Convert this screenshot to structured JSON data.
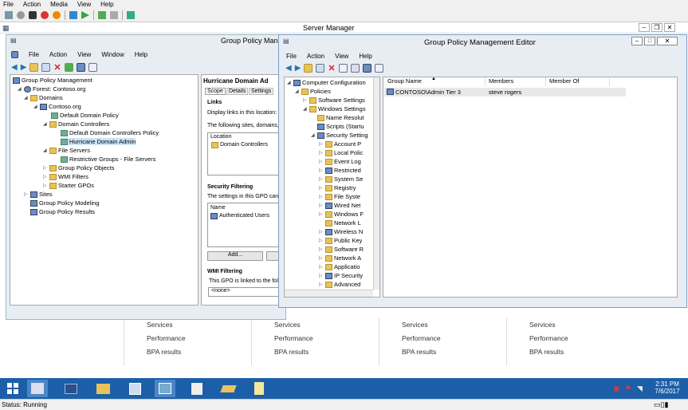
{
  "vm_menu": [
    "File",
    "Action",
    "Media",
    "View",
    "Help"
  ],
  "server_manager": {
    "title": "Server Manager",
    "tiles": [
      {
        "items": [
          "Services",
          "Performance",
          "BPA results"
        ]
      },
      {
        "items": [
          "Services",
          "Performance",
          "BPA results"
        ]
      },
      {
        "items": [
          "Services",
          "Performance",
          "BPA results"
        ]
      },
      {
        "items": [
          "Services",
          "Performance",
          "BPA results"
        ]
      }
    ]
  },
  "gpm": {
    "title": "Group Policy Manag",
    "menu": [
      "File",
      "Action",
      "View",
      "Window",
      "Help"
    ],
    "tree": [
      {
        "label": "Group Policy Management",
        "icon": "gpm-icon"
      },
      {
        "label": "Forest: Contoso.org",
        "icon": "forest-icon"
      },
      {
        "label": "Domains",
        "icon": "folder-icon"
      },
      {
        "label": "Contoso.org",
        "icon": "domain-icon"
      },
      {
        "label": "Default Domain Policy",
        "icon": "gpo-link-icon"
      },
      {
        "label": "Domain Controllers",
        "icon": "folder-icon"
      },
      {
        "label": "Default Domain Controllers Policy",
        "icon": "gpo-link-icon"
      },
      {
        "label": "Hurricane Domain Admin",
        "icon": "gpo-link-icon"
      },
      {
        "label": "File Servers",
        "icon": "folder-icon"
      },
      {
        "label": "Restrictive Groups - File Servers",
        "icon": "gpo-link-icon"
      },
      {
        "label": "Group Policy Objects",
        "icon": "folder-icon"
      },
      {
        "label": "WMI Filters",
        "icon": "folder-icon"
      },
      {
        "label": "Starter GPOs",
        "icon": "folder-icon"
      },
      {
        "label": "Sites",
        "icon": "sites-icon"
      },
      {
        "label": "Group Policy Modeling",
        "icon": "modeling-icon"
      },
      {
        "label": "Group Policy Results",
        "icon": "results-icon"
      }
    ],
    "right": {
      "header": "Hurricane Domain Ad",
      "tabs": [
        "Scope",
        "Details",
        "Settings"
      ],
      "links_title": "Links",
      "links_desc": "Display links in this location:",
      "links_desc2": "The following sites, domains,",
      "location_header": "Location",
      "location_value": "Domain Controllers",
      "security_title": "Security Filtering",
      "security_desc": "The settings in this GPO can",
      "name_header": "Name",
      "name_value": "Authenticated Users",
      "add_button": "Add...",
      "wmi_title": "WMI Filtering",
      "wmi_desc": "This GPO is linked to the follo",
      "wmi_value": "<none>"
    }
  },
  "editor": {
    "title": "Group Policy Management Editor",
    "menu": [
      "File",
      "Action",
      "View",
      "Help"
    ],
    "tree": [
      "Computer Configuration",
      "Policies",
      "Software Settings",
      "Windows Settings",
      "Name Resolut",
      "Scripts (Startu",
      "Security Setting",
      "Account P",
      "Local Polic",
      "Event Log",
      "Restricted",
      "System Se",
      "Registry",
      "File Syste",
      "Wired Net",
      "Windows F",
      "Network L",
      "Wireless N",
      "Public Key",
      "Software R",
      "Network A",
      "Applicatio",
      "IP Security",
      "Advanced"
    ],
    "columns": [
      "Group Name",
      "Members",
      "Member Of"
    ],
    "rows": [
      {
        "group": "CONTOSO\\Admin Tier 3",
        "members": "steve rogers",
        "member_of": ""
      }
    ]
  },
  "taskbar": {
    "time": "2:31 PM",
    "date": "7/6/2017"
  },
  "status": "Status: Running"
}
